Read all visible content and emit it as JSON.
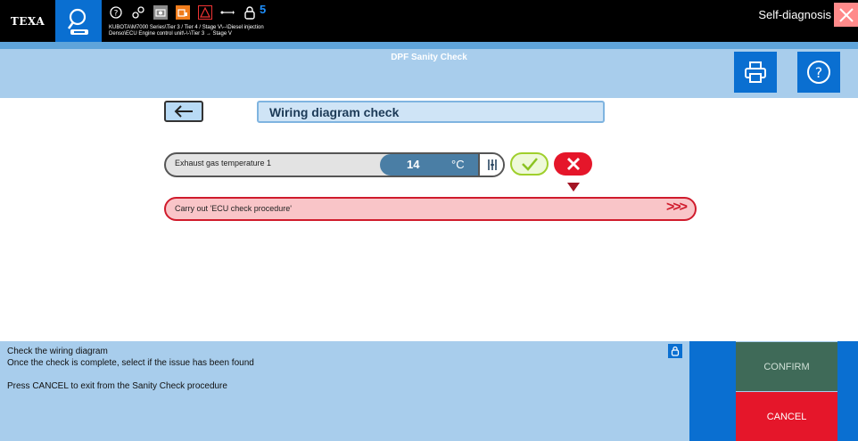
{
  "topbar": {
    "logo": "TEXA",
    "badge_count": "5",
    "path_line1": "KUBOTA\\M7000 Series\\Tier 3 / Tier 4 / Stage V\\--\\Diesel injection",
    "path_line2": "Denso\\ECU Engine control unit\\-\\-\\Tier 3 → Stage V",
    "mode_label": "Self-diagnosis"
  },
  "titlebar": {
    "title": "DPF Sanity Check"
  },
  "main": {
    "section_title": "Wiring diagram check",
    "parameter": {
      "label": "Exhaust gas temperature 1",
      "value": "14",
      "unit": "°C"
    },
    "action": {
      "label": "Carry out 'ECU check procedure'",
      "arrows": ">>>"
    }
  },
  "bottom": {
    "instr_line1": "Check the wiring diagram",
    "instr_line2": "Once the check is complete, select if the issue has been found",
    "instr_line3": "Press CANCEL to exit from the Sanity Check procedure",
    "confirm_label": "CONFIRM",
    "cancel_label": "CANCEL"
  },
  "colors": {
    "accent_blue": "#0a6fd1",
    "panel_blue": "#a8cdec",
    "cancel_red": "#e5162a",
    "confirm_green": "#3f6a58"
  },
  "icons": [
    "help-icon",
    "connection-icon",
    "camera-icon",
    "vehicle-icon",
    "warning-icon",
    "usb-icon",
    "lock-icon",
    "print-icon",
    "close-icon",
    "back-arrow-icon",
    "check-icon",
    "cross-icon"
  ]
}
